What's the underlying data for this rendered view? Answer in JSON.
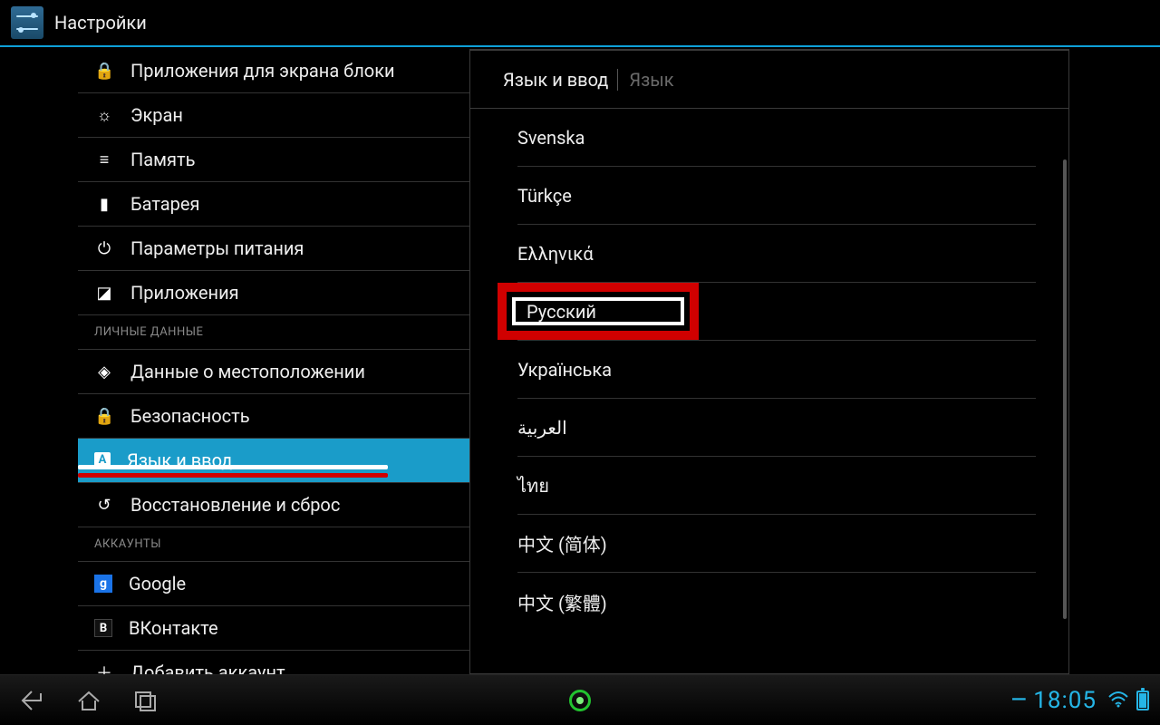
{
  "titlebar": {
    "title": "Настройки"
  },
  "sidebar": {
    "items": [
      {
        "icon": "lock-icon",
        "glyph": "🔒",
        "label": "Приложения для экрана блоки"
      },
      {
        "icon": "brightness-icon",
        "glyph": "☼",
        "label": "Экран"
      },
      {
        "icon": "storage-icon",
        "glyph": "≡",
        "label": "Память"
      },
      {
        "icon": "battery-icon",
        "glyph": "▮",
        "label": "Батарея"
      },
      {
        "icon": "power-icon",
        "glyph": "⏻",
        "label": "Параметры питания"
      },
      {
        "icon": "apps-icon",
        "glyph": "◪",
        "label": "Приложения"
      }
    ],
    "header_personal": "ЛИЧНЫЕ ДАННЫЕ",
    "personal": [
      {
        "icon": "location-icon",
        "glyph": "◈",
        "label": "Данные о местоположении"
      },
      {
        "icon": "lock-icon",
        "glyph": "🔒",
        "label": "Безопасность"
      },
      {
        "icon": "keyboard-icon",
        "glyph": "A",
        "label": "Язык и ввод",
        "selected": true
      },
      {
        "icon": "restore-icon",
        "glyph": "↺",
        "label": "Восстановление и сброс"
      }
    ],
    "header_accounts": "АККАУНТЫ",
    "accounts": [
      {
        "icon": "google-icon",
        "glyph": "g",
        "label": "Google"
      },
      {
        "icon": "vk-icon",
        "glyph": "B",
        "label": "ВКонтакте"
      },
      {
        "icon": "plus-icon",
        "glyph": "＋",
        "label": "Добавить аккаунт"
      }
    ]
  },
  "main": {
    "breadcrumb1": "Язык и ввод",
    "breadcrumb2": "Язык",
    "languages": [
      "Svenska",
      "Türkçe",
      "Ελληνικά",
      "Русский",
      "Українська",
      "العربية",
      "ไทย",
      "中文 (简体)",
      "中文 (繁體)"
    ],
    "highlight_index": 3
  },
  "navbar": {
    "time": "18:05"
  }
}
